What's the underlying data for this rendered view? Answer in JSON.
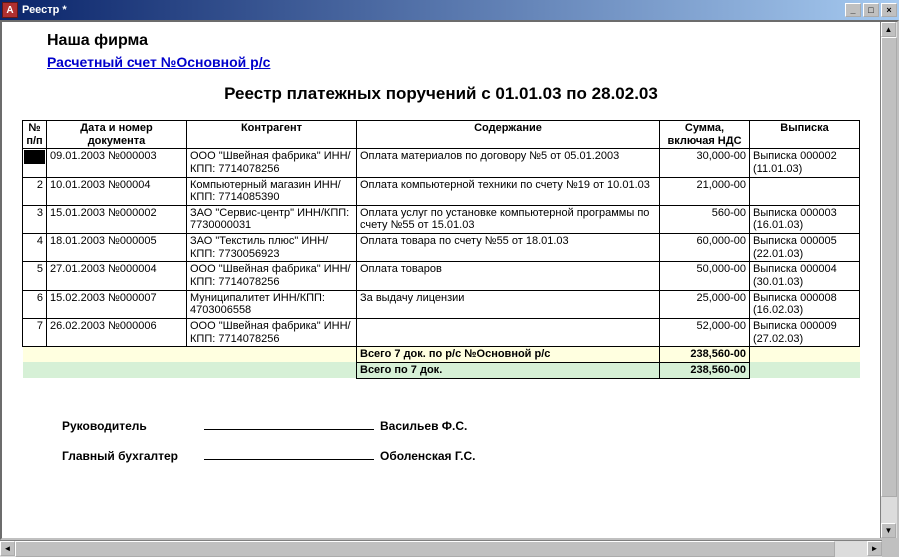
{
  "window": {
    "title": "Реестр  *",
    "icon_letter": "A"
  },
  "header": {
    "company": "Наша фирма",
    "account_link": "Расчетный счет №Основной р/с",
    "report_title": "Реестр платежных поручений с 01.01.03 по 28.02.03"
  },
  "table": {
    "headers": {
      "num": "№ п/п",
      "date": "Дата и номер документа",
      "contr": "Контрагент",
      "content": "Содержание",
      "sum": "Сумма, включая НДС",
      "vyp": "Выписка"
    },
    "rows": [
      {
        "num": "",
        "selected": true,
        "date": "09.01.2003 №000003",
        "contr": "ООО \"Швейная фабрика\"  ИНН/КПП: 7714078256",
        "content": "Оплата материалов по договору №5 от 05.01.2003",
        "sum": "30,000-00",
        "vyp": "Выписка 000002 (11.01.03)"
      },
      {
        "num": "2",
        "date": "10.01.2003 №00004",
        "contr": "Компьютерный магазин  ИНН/КПП: 7714085390",
        "content": "Оплата компьютерной техники по счету №19 от 10.01.03",
        "sum": "21,000-00",
        "vyp": ""
      },
      {
        "num": "3",
        "date": "15.01.2003 №000002",
        "contr": "ЗАО \"Сервис-центр\"  ИНН/КПП: 7730000031",
        "content": "Оплата услуг по установке компьютерной программы по счету №55 от 15.01.03",
        "sum": "560-00",
        "vyp": "Выписка 000003 (16.01.03)"
      },
      {
        "num": "4",
        "date": "18.01.2003 №000005",
        "contr": "ЗАО \"Текстиль плюс\"  ИНН/КПП: 7730056923",
        "content": "Оплата товара по счету №55 от 18.01.03",
        "sum": "60,000-00",
        "vyp": "Выписка 000005 (22.01.03)"
      },
      {
        "num": "5",
        "date": "27.01.2003 №000004",
        "contr": "ООО \"Швейная фабрика\"  ИНН/КПП: 7714078256",
        "content": "Оплата товаров",
        "sum": "50,000-00",
        "vyp": "Выписка 000004 (30.01.03)"
      },
      {
        "num": "6",
        "date": "15.02.2003 №000007",
        "contr": "Муниципалитет  ИНН/КПП: 4703006558",
        "content": "За выдачу лицензии",
        "sum": "25,000-00",
        "vyp": "Выписка 000008 (16.02.03)"
      },
      {
        "num": "7",
        "date": "26.02.2003 №000006",
        "contr": "ООО \"Швейная фабрика\"  ИНН/КПП: 7714078256",
        "content": "",
        "sum": "52,000-00",
        "vyp": "Выписка 000009 (27.02.03)"
      }
    ],
    "totals": [
      {
        "class": "total-row-yellow",
        "label": "Всего 7 док. по р/с №Основной р/с",
        "sum": "238,560-00"
      },
      {
        "class": "total-row-green",
        "label": "Всего по 7 док.",
        "sum": "238,560-00"
      }
    ]
  },
  "signatures": {
    "rows": [
      {
        "label": "Руководитель",
        "name": "Васильев Ф.С."
      },
      {
        "label": "Главный бухгалтер",
        "name": "Оболенская Г.С."
      }
    ]
  }
}
